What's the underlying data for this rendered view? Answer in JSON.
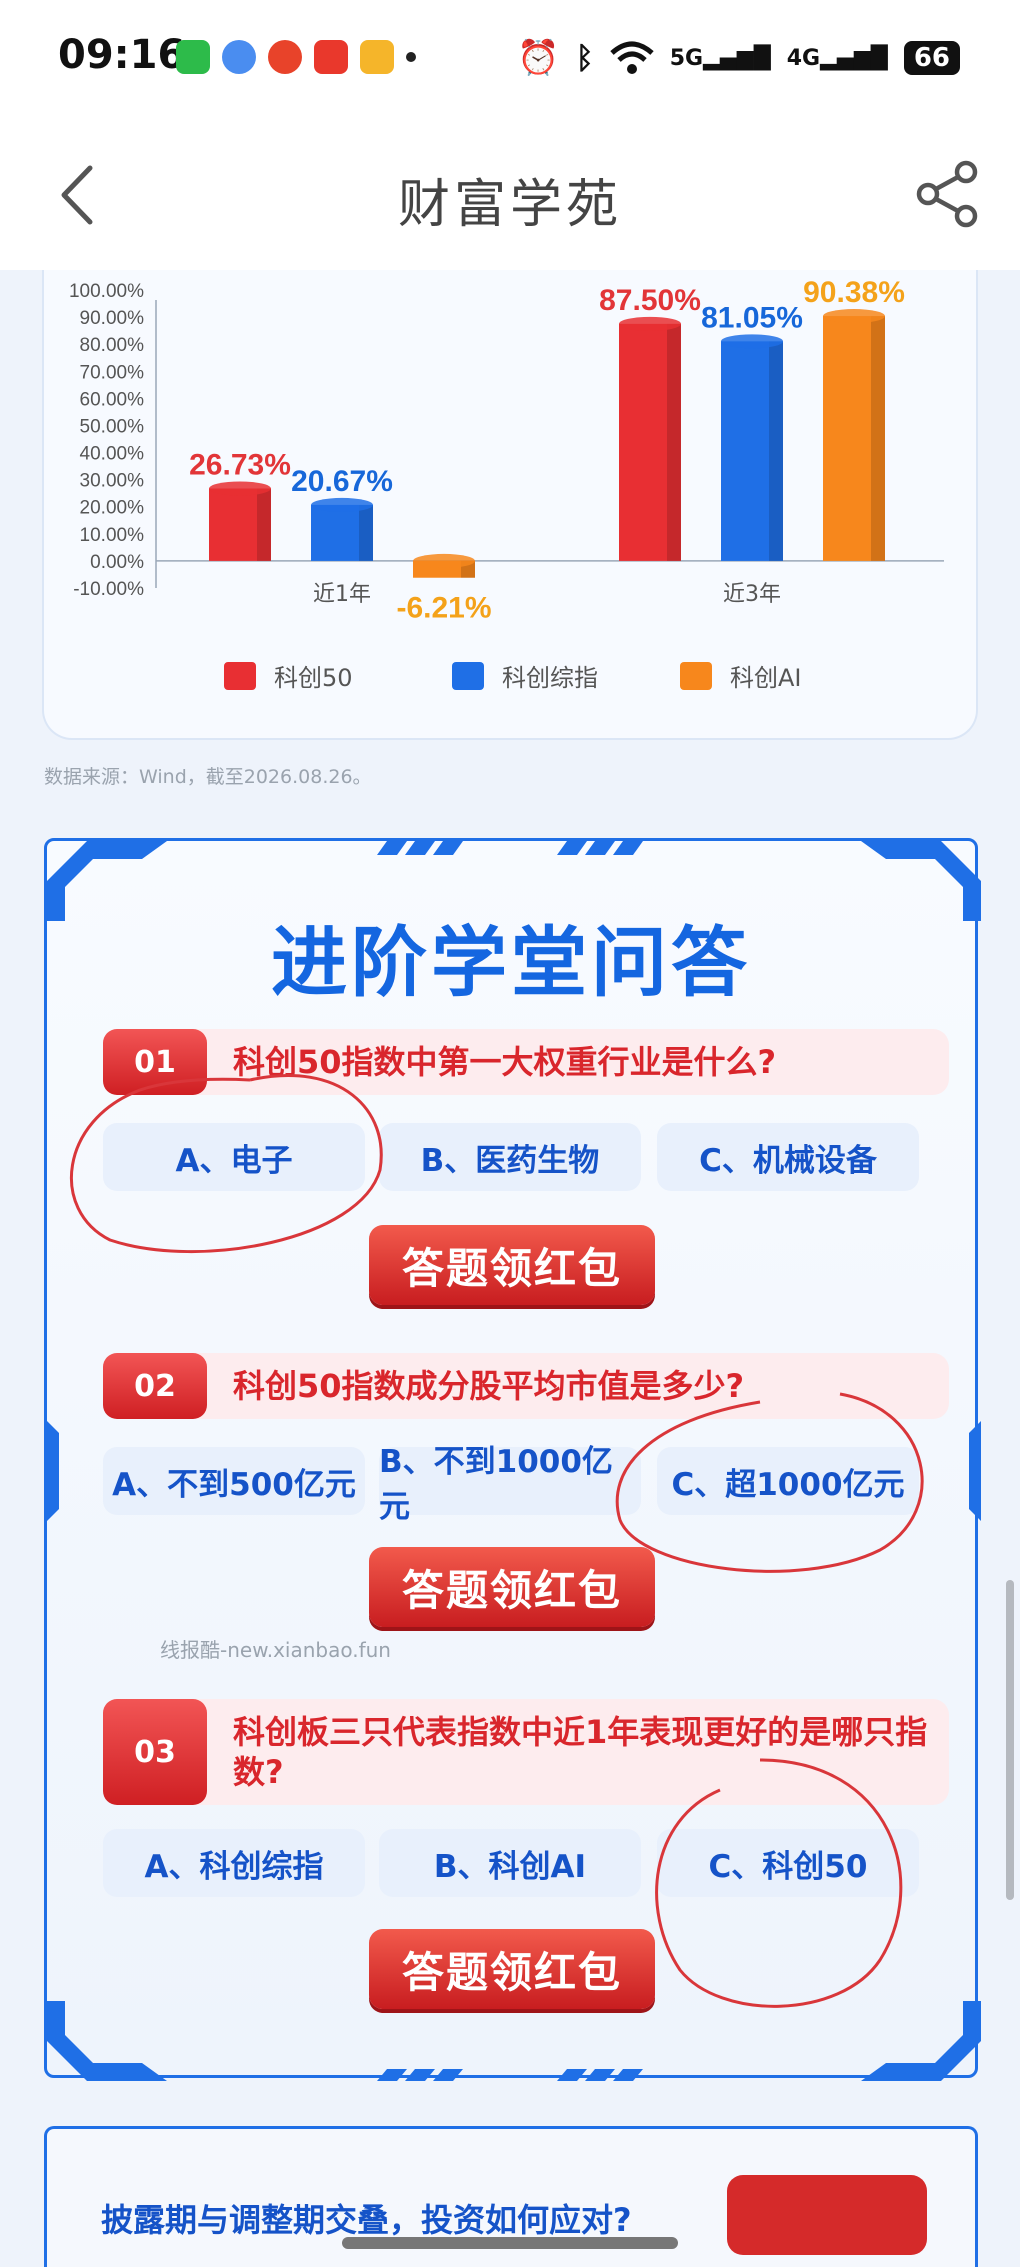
{
  "status_bar": {
    "time": "09:16",
    "signal_5g": "5G",
    "signal_4g": "4G",
    "battery": "66",
    "app_icon_colors": [
      "#2dbb4a",
      "#4a8df0",
      "#e8432a",
      "#e9382c",
      "#f5b52a"
    ]
  },
  "nav": {
    "title": "财富学苑",
    "back_icon": "chevron-left-icon",
    "share_icon": "share-icon"
  },
  "chart_data": {
    "type": "bar",
    "categories": [
      "近1年",
      "近3年"
    ],
    "series": [
      {
        "name": "科创50",
        "values": [
          26.73,
          87.5
        ],
        "color": "#e82f33"
      },
      {
        "name": "科创综指",
        "values": [
          20.67,
          81.05
        ],
        "color": "#1f6fe6"
      },
      {
        "name": "科创AI",
        "values": [
          -6.21,
          90.38
        ],
        "color": "#f7871c"
      }
    ],
    "data_labels": [
      [
        "26.73%",
        "87.50%"
      ],
      [
        "20.67%",
        "81.05%"
      ],
      [
        "-6.21%",
        "90.38%"
      ]
    ],
    "label_colors": [
      "#e23538",
      "#1767d9",
      "#f4a21a"
    ],
    "yticks": [
      "100.00%",
      "90.00%",
      "80.00%",
      "70.00%",
      "60.00%",
      "50.00%",
      "40.00%",
      "30.00%",
      "20.00%",
      "10.00%",
      "0.00%",
      "-10.00%"
    ],
    "ylim": [
      -10,
      100
    ],
    "legend_position": "bottom",
    "grid": false
  },
  "source_note": "数据来源：Wind，截至2026.08.26。",
  "quiz": {
    "title": "进阶学堂问答",
    "questions": [
      {
        "num": "01",
        "text": "科创50指数中第一大权重行业是什么?",
        "options": [
          "A、电子",
          "B、医药生物",
          "C、机械设备"
        ],
        "cta": "答题领红包"
      },
      {
        "num": "02",
        "text": "科创50指数成分股平均市值是多少?",
        "options": [
          "A、不到500亿元",
          "B、不到1000亿元",
          "C、超1000亿元"
        ],
        "cta": "答题领红包"
      },
      {
        "num": "03",
        "text": "科创板三只代表指数中近1年表现更好的是哪只指数?",
        "options": [
          "A、科创综指",
          "B、科创AI",
          "C、科创50"
        ],
        "cta": "答题领红包"
      }
    ]
  },
  "watermark": "线报酷-new.xianbao.fun",
  "next_section": {
    "title": "披露期与调整期交叠，投资如何应对?"
  }
}
